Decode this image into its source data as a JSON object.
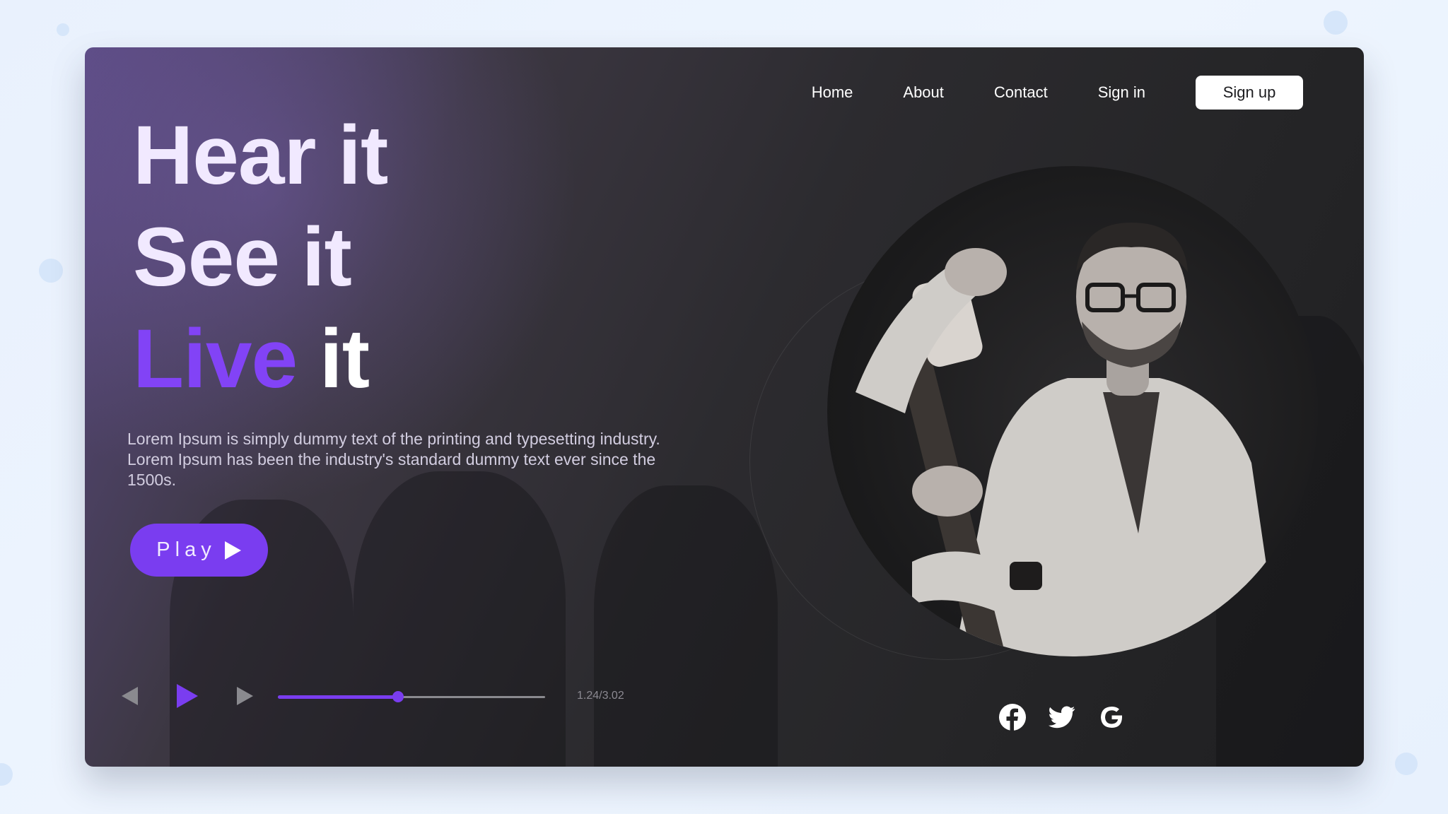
{
  "nav": {
    "items": [
      {
        "label": "Home"
      },
      {
        "label": "About"
      },
      {
        "label": "Contact"
      },
      {
        "label": "Sign in"
      }
    ],
    "signup_label": "Sign up"
  },
  "hero": {
    "line1": "Hear it",
    "line2": "See it",
    "line3_accent": "Live",
    "line3_rest": " it",
    "description": "Lorem Ipsum is simply dummy text of the printing and typesetting industry. Lorem Ipsum has been the industry's standard dummy text ever since the 1500s.",
    "play_label": "Play"
  },
  "player": {
    "time": "1.24/3.02",
    "progress_fraction": 0.45
  },
  "social": {
    "icons": [
      "facebook-icon",
      "twitter-icon",
      "google-icon"
    ]
  },
  "colors": {
    "accent": "#7a3df0",
    "hero_text": "#f1e9ff"
  }
}
